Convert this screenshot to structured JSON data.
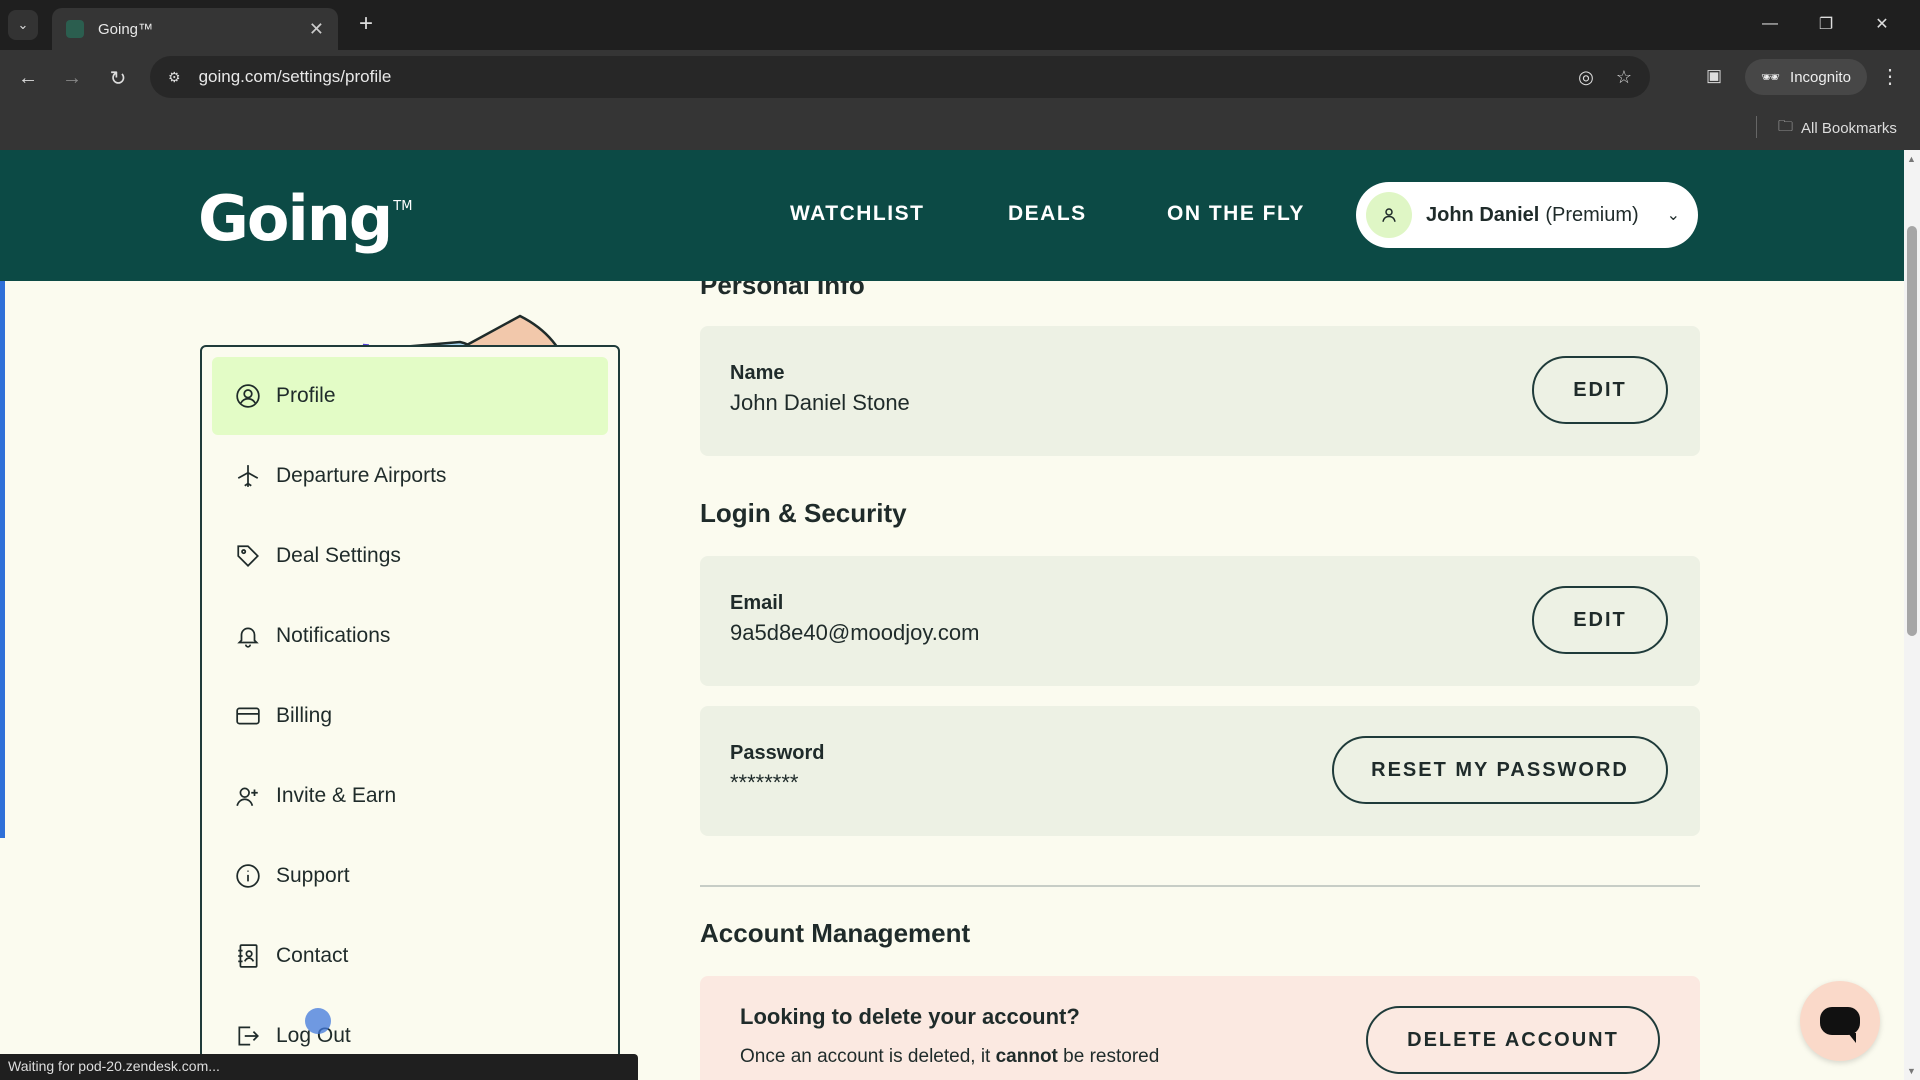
{
  "browser": {
    "tab_title": "Going™",
    "url": "going.com/settings/profile",
    "incognito_label": "Incognito",
    "bookmarks_label": "All Bookmarks",
    "status_text": "Waiting for pod-20.zendesk.com..."
  },
  "header": {
    "logo": "Going",
    "logo_tm": "TM",
    "nav": [
      "WATCHLIST",
      "DEALS",
      "ON THE FLY"
    ],
    "account_name": "John Daniel",
    "account_plan": "(Premium)"
  },
  "sidebar": {
    "items": [
      {
        "label": "Profile",
        "icon": "user-circle-icon"
      },
      {
        "label": "Departure Airports",
        "icon": "airplane-icon"
      },
      {
        "label": "Deal Settings",
        "icon": "tag-icon"
      },
      {
        "label": "Notifications",
        "icon": "bell-icon"
      },
      {
        "label": "Billing",
        "icon": "credit-card-icon"
      },
      {
        "label": "Invite & Earn",
        "icon": "add-user-icon"
      },
      {
        "label": "Support",
        "icon": "info-icon"
      },
      {
        "label": "Contact",
        "icon": "contact-book-icon"
      },
      {
        "label": "Log Out",
        "icon": "logout-icon"
      }
    ]
  },
  "personal_info": {
    "title": "Personal Info",
    "name_label": "Name",
    "name_value": "John Daniel Stone",
    "edit_label": "EDIT"
  },
  "login_security": {
    "title": "Login & Security",
    "email_label": "Email",
    "email_value": "9a5d8e40@moodjoy.com",
    "edit_label": "EDIT",
    "password_label": "Password",
    "password_value": "********",
    "reset_label": "RESET MY PASSWORD"
  },
  "account_management": {
    "title": "Account Management",
    "delete_title": "Looking to delete your account?",
    "delete_desc_before": "Once an account is deleted, it ",
    "delete_desc_bold": "cannot",
    "delete_desc_after": " be restored",
    "delete_button": "DELETE ACCOUNT"
  },
  "colors": {
    "header_bg": "#0c4a45",
    "active_item_bg": "#e3fcc6",
    "card_bg": "#edf1e4",
    "danger_bg": "#fbe9e1",
    "page_bg": "#fbfbef"
  }
}
